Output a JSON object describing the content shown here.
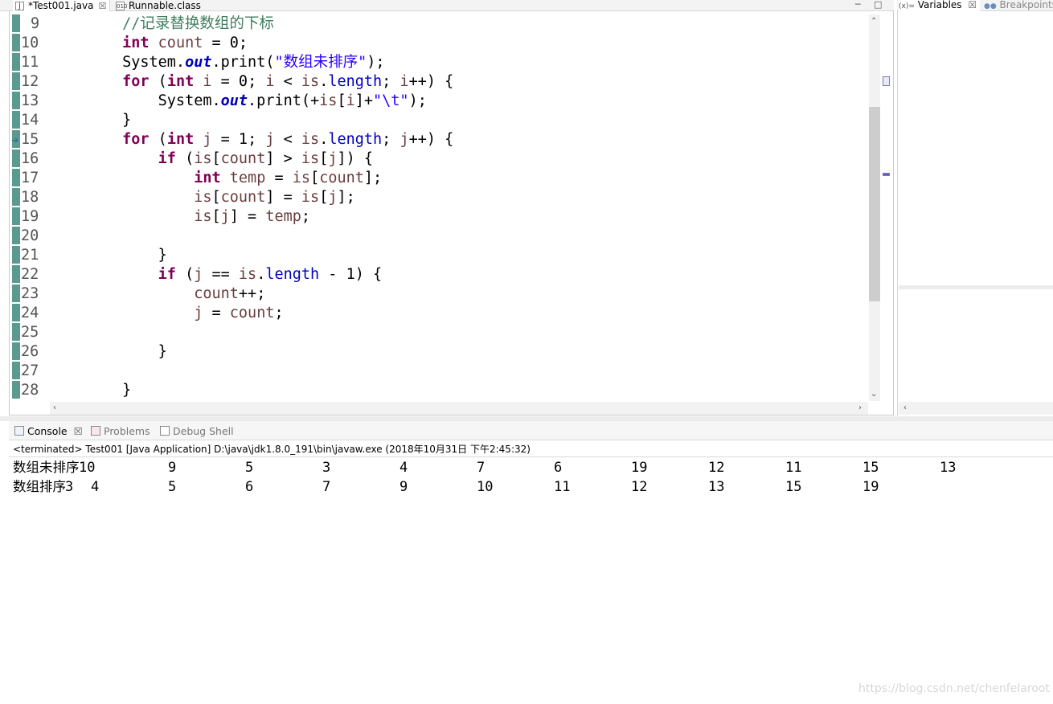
{
  "editor": {
    "tabs": [
      {
        "label": "*Test001.java",
        "icon": "java-file-icon",
        "close": "☒"
      },
      {
        "label": "Runnable.class",
        "icon": "class-file-icon"
      }
    ],
    "line_numbers": [
      "9",
      "10",
      "11",
      "12",
      "13",
      "14",
      "15",
      "16",
      "17",
      "18",
      "19",
      "20",
      "21",
      "22",
      "23",
      "24",
      "25",
      "26",
      "27",
      "28"
    ]
  },
  "right_panel": {
    "tabs": [
      {
        "label": "Variables",
        "icon": "variables-icon",
        "prefix": "(x)="
      },
      {
        "label": "Breakpoints",
        "icon": "breakpoints-icon"
      }
    ]
  },
  "console": {
    "tabs": [
      {
        "label": "Console",
        "close": "☒"
      },
      {
        "label": "Problems"
      },
      {
        "label": "Debug Shell"
      }
    ],
    "status": "<terminated> Test001 [Java Application] D:\\java\\jdk1.8.0_191\\bin\\javaw.exe (2018年10月31日 下午2:45:32)",
    "rows": [
      {
        "prefix": "数组未排序",
        "values": [
          "10",
          "9",
          "5",
          "3",
          "4",
          "7",
          "6",
          "19",
          "12",
          "11",
          "15",
          "13"
        ]
      },
      {
        "prefix": "数组排序",
        "values": [
          "3",
          "4",
          "5",
          "6",
          "7",
          "9",
          "10",
          "11",
          "12",
          "13",
          "15",
          "19"
        ]
      }
    ]
  },
  "watermark": "https://blog.csdn.net/chenfelaroot",
  "colors": {
    "keyword": "#7f0055",
    "comment": "#3f7f5f",
    "string": "#2a00ff",
    "field": "#0000c0",
    "gutter": "#5b9a8e"
  }
}
